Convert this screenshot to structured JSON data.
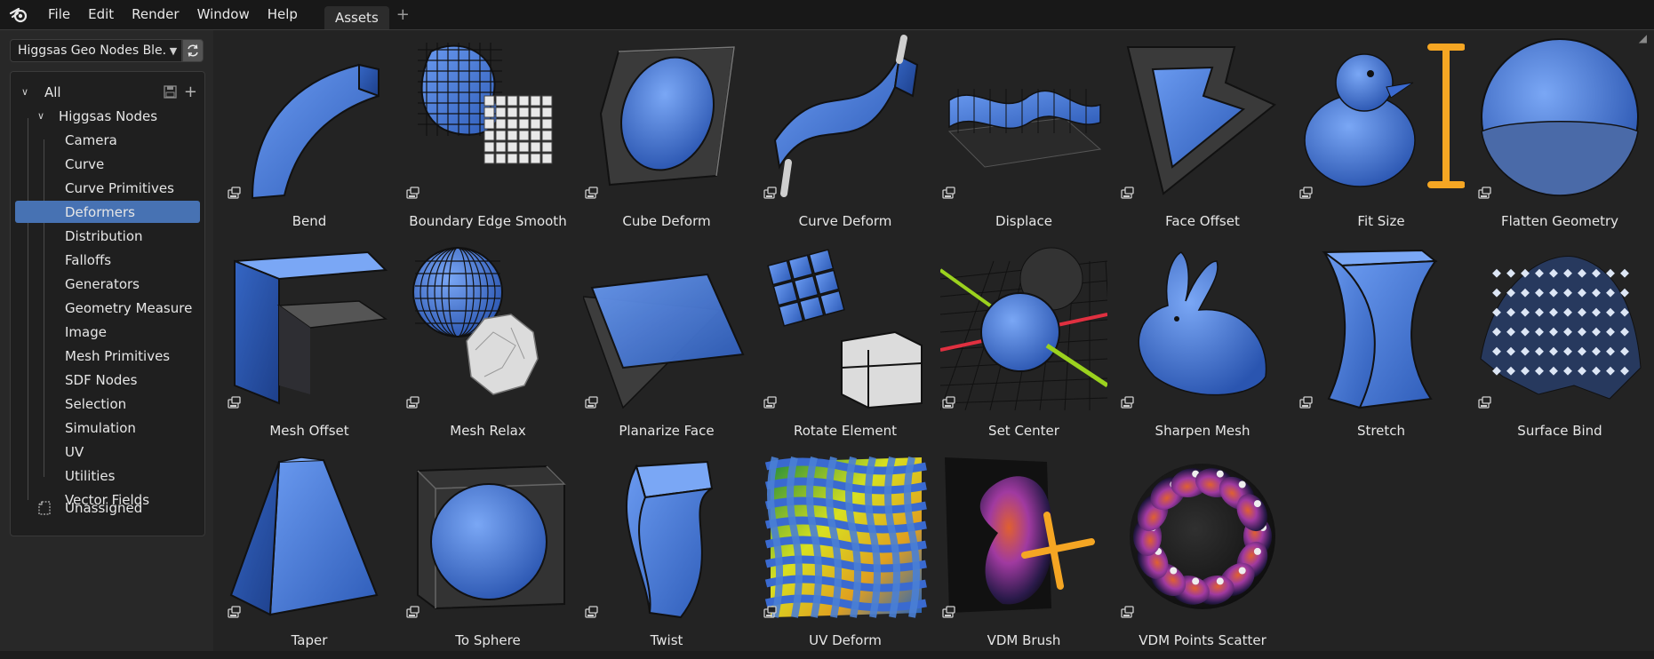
{
  "menubar": {
    "items": [
      "File",
      "Edit",
      "Render",
      "Window",
      "Help"
    ],
    "tab": "Assets",
    "add_tab": "+"
  },
  "sidebar": {
    "library": "Higgsas Geo Nodes Ble...",
    "tree": {
      "root": "All",
      "group": "Higgsas Nodes",
      "items": [
        "Camera",
        "Curve",
        "Curve Primitives",
        "Deformers",
        "Distribution",
        "Falloffs",
        "Generators",
        "Geometry Measure",
        "Image",
        "Mesh Primitives",
        "SDF Nodes",
        "Selection",
        "Simulation",
        "UV",
        "Utilities",
        "Vector Fields"
      ],
      "selected": "Deformers",
      "unassigned": "Unassigned"
    }
  },
  "assets": [
    {
      "name": "Bend",
      "icon": "bend-thumbnail"
    },
    {
      "name": "Boundary Edge Smooth",
      "icon": "boundary-edge-smooth-thumbnail"
    },
    {
      "name": "Cube Deform",
      "icon": "cube-deform-thumbnail"
    },
    {
      "name": "Curve Deform",
      "icon": "curve-deform-thumbnail"
    },
    {
      "name": "Displace",
      "icon": "displace-thumbnail"
    },
    {
      "name": "Face Offset",
      "icon": "face-offset-thumbnail"
    },
    {
      "name": "Fit Size",
      "icon": "fit-size-thumbnail"
    },
    {
      "name": "Flatten Geometry",
      "icon": "flatten-geometry-thumbnail"
    },
    {
      "name": "Mesh Offset",
      "icon": "mesh-offset-thumbnail"
    },
    {
      "name": "Mesh Relax",
      "icon": "mesh-relax-thumbnail"
    },
    {
      "name": "Planarize Face",
      "icon": "planarize-face-thumbnail"
    },
    {
      "name": "Rotate Element",
      "icon": "rotate-element-thumbnail"
    },
    {
      "name": "Set Center",
      "icon": "set-center-thumbnail"
    },
    {
      "name": "Sharpen Mesh",
      "icon": "sharpen-mesh-thumbnail"
    },
    {
      "name": "Stretch",
      "icon": "stretch-thumbnail"
    },
    {
      "name": "Surface Bind",
      "icon": "surface-bind-thumbnail"
    },
    {
      "name": "Taper",
      "icon": "taper-thumbnail"
    },
    {
      "name": "To Sphere",
      "icon": "to-sphere-thumbnail"
    },
    {
      "name": "Twist",
      "icon": "twist-thumbnail"
    },
    {
      "name": "UV Deform",
      "icon": "uv-deform-thumbnail"
    },
    {
      "name": "VDM Brush",
      "icon": "vdm-brush-thumbnail"
    },
    {
      "name": "VDM Points Scatter",
      "icon": "vdm-points-scatter-thumbnail"
    }
  ],
  "colors": {
    "accent_blue": "#4772b3",
    "mesh_blue": "#4a7fd4",
    "orange": "#f5a623",
    "background": "#232323"
  }
}
